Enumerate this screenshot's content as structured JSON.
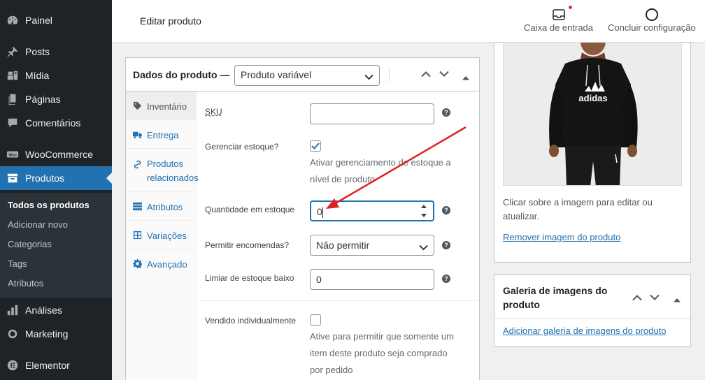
{
  "sidebar": {
    "items": [
      {
        "label": "Painel",
        "icon": "dashboard-icon"
      },
      {
        "label": "Posts",
        "icon": "pin-icon"
      },
      {
        "label": "Mídia",
        "icon": "media-icon"
      },
      {
        "label": "Páginas",
        "icon": "pages-icon"
      },
      {
        "label": "Comentários",
        "icon": "comments-icon"
      },
      {
        "label": "WooCommerce",
        "icon": "woocommerce-icon"
      },
      {
        "label": "Produtos",
        "icon": "archive-icon"
      },
      {
        "label": "Análises",
        "icon": "bar-chart-icon"
      },
      {
        "label": "Marketing",
        "icon": "megaphone-icon"
      },
      {
        "label": "Elementor",
        "icon": "elementor-icon"
      }
    ],
    "submenu": [
      "Todos os produtos",
      "Adicionar novo",
      "Categorias",
      "Tags",
      "Atributos"
    ]
  },
  "header": {
    "title": "Editar produto",
    "inbox_label": "Caixa de entrada",
    "setup_label": "Concluir configuração"
  },
  "product_data": {
    "title": "Dados do produto —",
    "type_selected": "Produto variável",
    "tabs": [
      {
        "label": "Inventário",
        "icon": "tag-icon"
      },
      {
        "label": "Entrega",
        "icon": "truck-icon"
      },
      {
        "label": "Produtos relacionados",
        "icon": "link-icon"
      },
      {
        "label": "Atributos",
        "icon": "list-icon"
      },
      {
        "label": "Variações",
        "icon": "grid-icon"
      },
      {
        "label": "Avançado",
        "icon": "gear-icon"
      }
    ],
    "fields": {
      "sku_label": "SKU",
      "sku_value": "",
      "manage_stock_label": "Gerenciar estoque?",
      "manage_stock_checked": true,
      "manage_stock_desc": "Ativar gerenciamento de estoque a nível de produto",
      "stock_qty_label": "Quantidade em estoque",
      "stock_qty_value": "0",
      "backorders_label": "Permitir encomendas?",
      "backorders_value": "Não permitir",
      "low_stock_label": "Limiar de estoque baixo",
      "low_stock_value": "0",
      "sold_individually_label": "Vendido individualmente",
      "sold_individually_checked": false,
      "sold_individually_desc": "Ative para permitir que somente um item deste produto seja comprado por pedido"
    }
  },
  "product_image": {
    "hint": "Clicar sobre a imagem para editar ou atualizar.",
    "remove_link": "Remover imagem do produto",
    "logo_text": "adidas"
  },
  "gallery": {
    "title": "Galeria de imagens do produto",
    "add_link": "Adicionar galeria de imagens do produto"
  },
  "colors": {
    "accent": "#2271b1",
    "sidebar_bg": "#1d2327",
    "annotation_arrow": "#e02020"
  }
}
